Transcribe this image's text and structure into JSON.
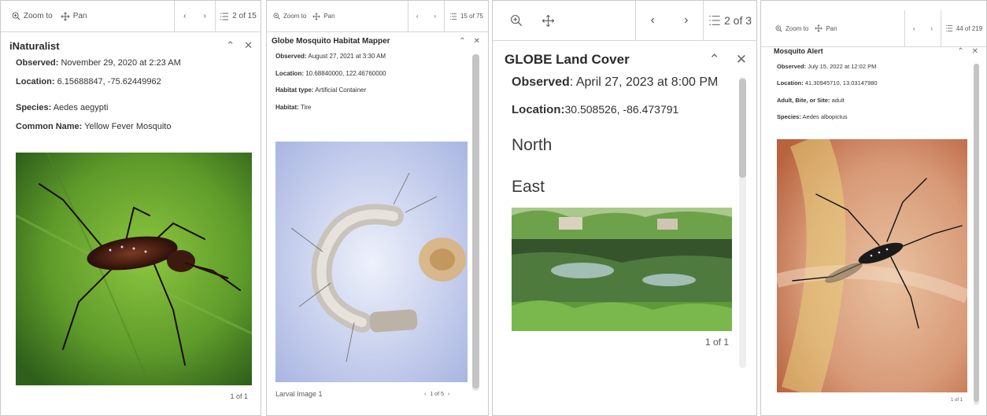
{
  "panels": [
    {
      "toolbar": {
        "zoom_label": "Zoom to",
        "pan_label": "Pan",
        "count": "2 of 15"
      },
      "title": "iNaturalist",
      "fields": [
        {
          "label": "Observed:",
          "value": "November 29, 2020 at 2:23 AM"
        },
        {
          "label": "Location:",
          "value": "6.15688847, -75.62449962"
        },
        {
          "label": "Species:",
          "value": "Aedes aegypti"
        },
        {
          "label": "Common Name:",
          "value": "Yellow Fever Mosquito"
        }
      ],
      "image_page": "1 of 1"
    },
    {
      "toolbar": {
        "zoom_label": "Zoom to",
        "pan_label": "Pan",
        "count": "15 of 75"
      },
      "title": "Globe Mosquito Habitat Mapper",
      "fields": [
        {
          "label": "Observed:",
          "value": "August 27, 2021 at 3:30 AM"
        },
        {
          "label": "Location:",
          "value": "10.68840000, 122.46760000"
        },
        {
          "label": "Habitat type:",
          "value": "Artificial Container"
        },
        {
          "label": "Habitat:",
          "value": "Tire"
        }
      ],
      "image_caption": "Larval Image 1",
      "image_page": "1 of 5"
    },
    {
      "toolbar": {
        "count": "2 of 3"
      },
      "title": "GLOBE Land Cover",
      "fields": [
        {
          "label": "Observed",
          "value": ": April 27, 2023 at 8:00 PM"
        },
        {
          "label": "Location:",
          "value": "30.508526, -86.473791"
        }
      ],
      "directions": [
        "North",
        "East"
      ],
      "image_page": "1 of 1"
    },
    {
      "toolbar": {
        "zoom_label": "Zoom to",
        "pan_label": "Pan",
        "count": "44 of 219"
      },
      "title": "Mosquito Alert",
      "fields": [
        {
          "label": "Observed:",
          "value": "July 15, 2022 at 12:02 PM"
        },
        {
          "label": "Location:",
          "value": "41.30945710, 13.03147980"
        },
        {
          "label": "Adult, Bite, or Site:",
          "value": "adult"
        },
        {
          "label": "Species:",
          "value": "Aedes albopictus"
        }
      ],
      "image_page": "1 of 1"
    }
  ],
  "icons": {
    "zoom": "zoom-to-icon",
    "pan": "pan-icon",
    "prev": "chevron-left-icon",
    "next": "chevron-right-icon",
    "list": "feature-list-icon",
    "collapse": "chevron-up-icon",
    "close": "close-icon"
  }
}
